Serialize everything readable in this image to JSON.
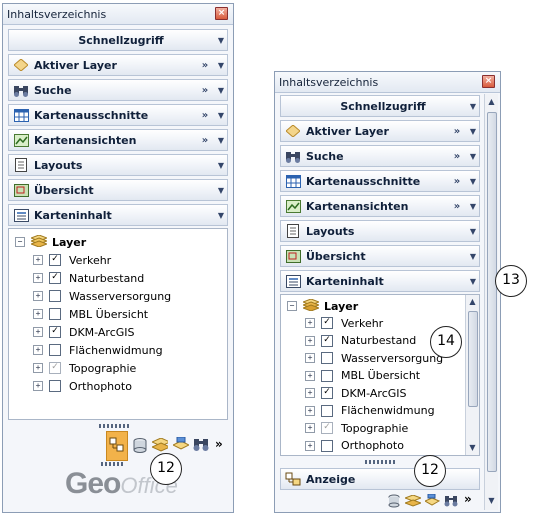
{
  "panel_title": "Inhaltsverzeichnis",
  "close_glyph": "×",
  "sections": {
    "schnellzugriff": "Schnellzugriff",
    "aktiver_layer": "Aktiver Layer",
    "suche": "Suche",
    "kartenausschnitte": "Kartenausschnitte",
    "kartenansichten": "Kartenansichten",
    "layouts": "Layouts",
    "uebersicht": "Übersicht",
    "karteninhalt": "Karteninhalt",
    "anzeige": "Anzeige"
  },
  "toc": {
    "group_label": "Layer",
    "layers": [
      {
        "name": "Verkehr",
        "checked": true
      },
      {
        "name": "Naturbestand",
        "checked": true
      },
      {
        "name": "Wasserversorgung",
        "checked": false
      },
      {
        "name": "MBL Übersicht",
        "checked": false
      },
      {
        "name": "DKM-ArcGIS",
        "checked": true
      },
      {
        "name": "Flächenwidmung",
        "checked": false
      },
      {
        "name": "Topographie",
        "checked": "grayed"
      },
      {
        "name": "Orthophoto",
        "checked": false
      }
    ]
  },
  "glyphs": {
    "more": "»",
    "dropdown": "▼",
    "expand": "+",
    "collapse": "−",
    "check": "✓",
    "overflow": "»"
  },
  "callouts": {
    "a": "12",
    "b": "12",
    "c": "13",
    "d": "14"
  },
  "logo": {
    "part1": "Geo",
    "part2": "Office"
  },
  "colors": {
    "accent": "#e8a23a",
    "header_text": "#10203a",
    "border": "#8c9db5"
  }
}
